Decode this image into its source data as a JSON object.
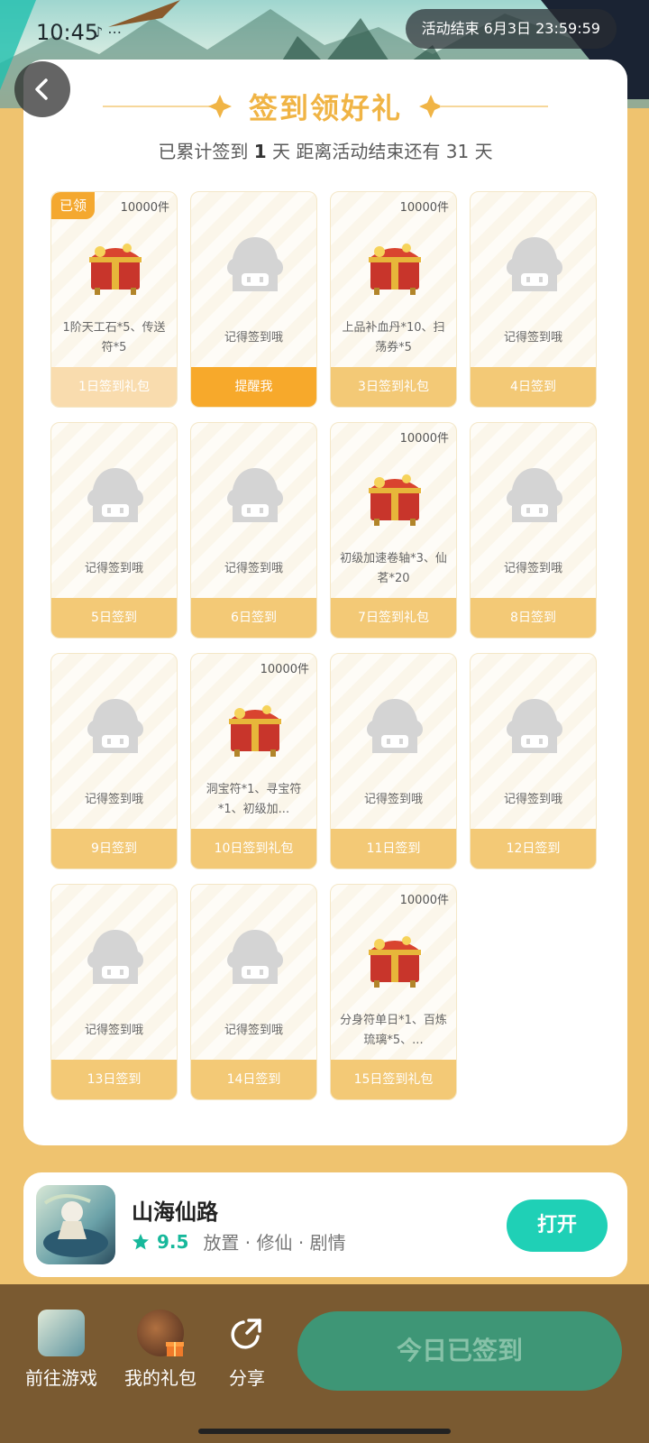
{
  "status_bar": {
    "time": "10:45",
    "pill_text": "活动结束  6月3日  23:59:59"
  },
  "header": {
    "title": "签到领好礼",
    "subtitle_prefix": "已累计签到",
    "signed_days": "1",
    "subtitle_mid": "天   距离活动结束还有",
    "remaining_days": "31",
    "subtitle_suffix": "天"
  },
  "days": [
    {
      "label": "1日签到礼包",
      "desc": "1阶天工石*5、传送符*5",
      "qty": "10000件",
      "badge": "已领",
      "state": "claimed",
      "gift": true
    },
    {
      "label": "提醒我",
      "desc": "记得签到哦",
      "qty": "",
      "badge": "",
      "state": "remind",
      "gift": false
    },
    {
      "label": "3日签到礼包",
      "desc": "上品补血丹*10、扫荡券*5",
      "qty": "10000件",
      "badge": "",
      "state": "normal",
      "gift": true
    },
    {
      "label": "4日签到",
      "desc": "记得签到哦",
      "qty": "",
      "badge": "",
      "state": "normal",
      "gift": false
    },
    {
      "label": "5日签到",
      "desc": "记得签到哦",
      "qty": "",
      "badge": "",
      "state": "normal",
      "gift": false
    },
    {
      "label": "6日签到",
      "desc": "记得签到哦",
      "qty": "",
      "badge": "",
      "state": "normal",
      "gift": false
    },
    {
      "label": "7日签到礼包",
      "desc": "初级加速卷轴*3、仙茗*20",
      "qty": "10000件",
      "badge": "",
      "state": "normal",
      "gift": true
    },
    {
      "label": "8日签到",
      "desc": "记得签到哦",
      "qty": "",
      "badge": "",
      "state": "normal",
      "gift": false
    },
    {
      "label": "9日签到",
      "desc": "记得签到哦",
      "qty": "",
      "badge": "",
      "state": "normal",
      "gift": false
    },
    {
      "label": "10日签到礼包",
      "desc": "洞宝符*1、寻宝符*1、初级加...",
      "qty": "10000件",
      "badge": "",
      "state": "normal",
      "gift": true
    },
    {
      "label": "11日签到",
      "desc": "记得签到哦",
      "qty": "",
      "badge": "",
      "state": "normal",
      "gift": false
    },
    {
      "label": "12日签到",
      "desc": "记得签到哦",
      "qty": "",
      "badge": "",
      "state": "normal",
      "gift": false
    },
    {
      "label": "13日签到",
      "desc": "记得签到哦",
      "qty": "",
      "badge": "",
      "state": "normal",
      "gift": false
    },
    {
      "label": "14日签到",
      "desc": "记得签到哦",
      "qty": "",
      "badge": "",
      "state": "normal",
      "gift": false
    },
    {
      "label": "15日签到礼包",
      "desc": "分身符单日*1、百炼琉璃*5、...",
      "qty": "10000件",
      "badge": "",
      "state": "normal",
      "gift": true
    }
  ],
  "app": {
    "name": "山海仙路",
    "rating": "9.5",
    "tags": "放置 · 修仙 · 剧情",
    "open_label": "打开"
  },
  "bottom": {
    "go_game": "前往游戏",
    "my_gifts": "我的礼包",
    "share": "分享",
    "signed_label": "今日已签到"
  },
  "colors": {
    "accent_gold": "#f0b445",
    "card_button": "#f3c976",
    "remind_button": "#f7a92b",
    "open_button": "#1fd0b6",
    "signed_button": "#3e9676",
    "bottom_bar": "#7a5a31"
  }
}
